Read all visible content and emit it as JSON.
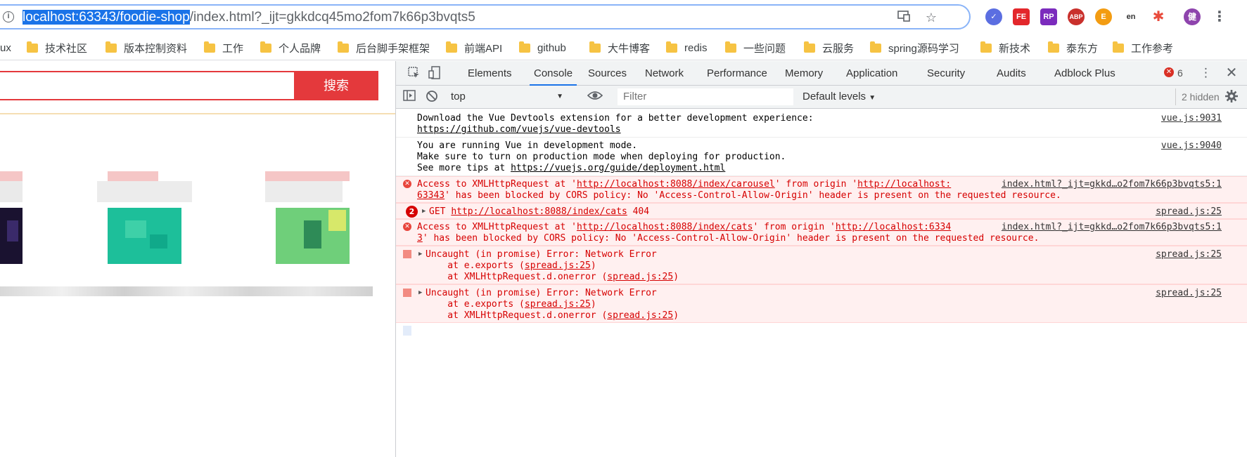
{
  "browser": {
    "url_selected": "localhost:63343/foodie-shop",
    "url_rest": "/index.html?_ijt=gkkdcq45mo2fom7k66p3bvqts5",
    "info_icon": "i",
    "cast_icon": "cast-icon",
    "star_icon": "☆",
    "menu_icon": "⋮",
    "extensions": [
      {
        "name": "ext-check",
        "label": "✓",
        "color": "#5b6ee1"
      },
      {
        "name": "ext-fe",
        "label": "FE",
        "color": "#e3272b"
      },
      {
        "name": "ext-rp",
        "label": "RP",
        "color": "#7b2bbd"
      },
      {
        "name": "ext-abp",
        "label": "ABP",
        "color": "#c9302c"
      },
      {
        "name": "ext-e",
        "label": "E",
        "color": "#f39c12"
      },
      {
        "name": "ext-en",
        "label": "en",
        "color": "#333333"
      },
      {
        "name": "ext-pinwheel",
        "label": "✱",
        "color": "#e94b3c"
      }
    ],
    "avatar": "健",
    "avatar_color": "#8e44ad"
  },
  "bookmarks": [
    "ux",
    "技术社区",
    "版本控制资料",
    "工作",
    "个人品牌",
    "后台脚手架框架",
    "前端API",
    "github",
    "大牛博客",
    "redis",
    "一些问题",
    "云服务",
    "spring源码学习",
    "新技术",
    "泰东方",
    "工作参考"
  ],
  "page": {
    "search_button": "搜索"
  },
  "devtools": {
    "tabs": [
      "Elements",
      "Console",
      "Sources",
      "Network",
      "Performance",
      "Memory",
      "Application",
      "Security",
      "Audits",
      "Adblock Plus"
    ],
    "active_tab": "Console",
    "error_count": "6",
    "context": "top",
    "filter_placeholder": "Filter",
    "levels": "Default levels",
    "hidden": "2 hidden"
  },
  "console": {
    "m1": {
      "l1": "Download the Vue Devtools extension for a better development experience:",
      "l2": "https://github.com/vuejs/vue-devtools",
      "src": "vue.js:9031"
    },
    "m2": {
      "l1": "You are running Vue in development mode.",
      "l2": "Make sure to turn on production mode when deploying for production.",
      "l3a": "See more tips at ",
      "l3b": "https://vuejs.org/guide/deployment.html",
      "src": "vue.js:9040"
    },
    "m3": {
      "a": "Access to XMLHttpRequest at '",
      "b": "http://localhost:8088/index/carousel",
      "c": "' from origin '",
      "d": "http://localhost:",
      "src1": "index.html?_ijt=gkkd…o2fom7k66p3bvqts5:1",
      "l2a": "63343",
      "l2b": "' has been blocked by CORS policy: No 'Access-Control-Allow-Origin' header is present on the requested resource."
    },
    "m4": {
      "count": "2",
      "a": "GET ",
      "b": "http://localhost:8088/index/cats",
      "c": " 404",
      "src": "spread.js:25"
    },
    "m5": {
      "a": "Access to XMLHttpRequest at '",
      "b": "http://localhost:8088/index/cats",
      "c": "' from origin '",
      "d": "http://localhost:6334",
      "src1": "index.html?_ijt=gkkd…o2fom7k66p3bvqts5:1",
      "l2a": "3",
      "l2b": "' has been blocked by CORS policy: No 'Access-Control-Allow-Origin' header is present on the requested resource."
    },
    "m6": {
      "l1": "Uncaught (in promise) Error: Network Error",
      "l2a": "    at e.exports (",
      "l2b": "spread.js:25",
      "l2c": ")",
      "l3a": "    at XMLHttpRequest.d.onerror (",
      "l3b": "spread.js:25",
      "l3c": ")",
      "src": "spread.js:25"
    },
    "m7": {
      "l1": "Uncaught (in promise) Error: Network Error",
      "l2a": "    at e.exports (",
      "l2b": "spread.js:25",
      "l2c": ")",
      "l3a": "    at XMLHttpRequest.d.onerror (",
      "l3b": "spread.js:25",
      "l3c": ")",
      "src": "spread.js:25"
    }
  }
}
